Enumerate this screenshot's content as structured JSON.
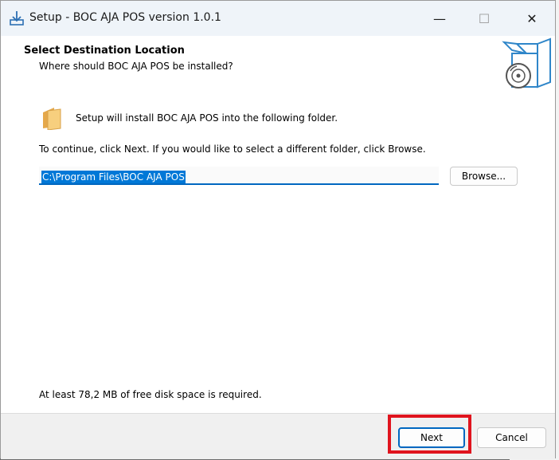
{
  "window": {
    "title": "Setup - BOC AJA POS version 1.0.1",
    "controls": {
      "minimize": "—",
      "maximize": "☐",
      "close": "✕"
    }
  },
  "header": {
    "title": "Select Destination Location",
    "subtitle": "Where should BOC AJA POS be installed?"
  },
  "body": {
    "intro": "Setup will install BOC AJA POS into the following folder.",
    "instructions": "To continue, click Next. If you would like to select a different folder, click Browse.",
    "install_path": "C:\\Program Files\\BOC AJA POS",
    "browse_label": "Browse...",
    "disk_space": "At least 78,2 MB of free disk space is required."
  },
  "footer": {
    "next_label": "Next",
    "cancel_label": "Cancel"
  },
  "icons": {
    "title": "setup-download-icon",
    "logo": "setup-box-disc-icon",
    "folder": "folder-icon"
  },
  "colors": {
    "accent": "#0067c0",
    "selection": "#0078d7",
    "highlight": "#e0141e"
  }
}
